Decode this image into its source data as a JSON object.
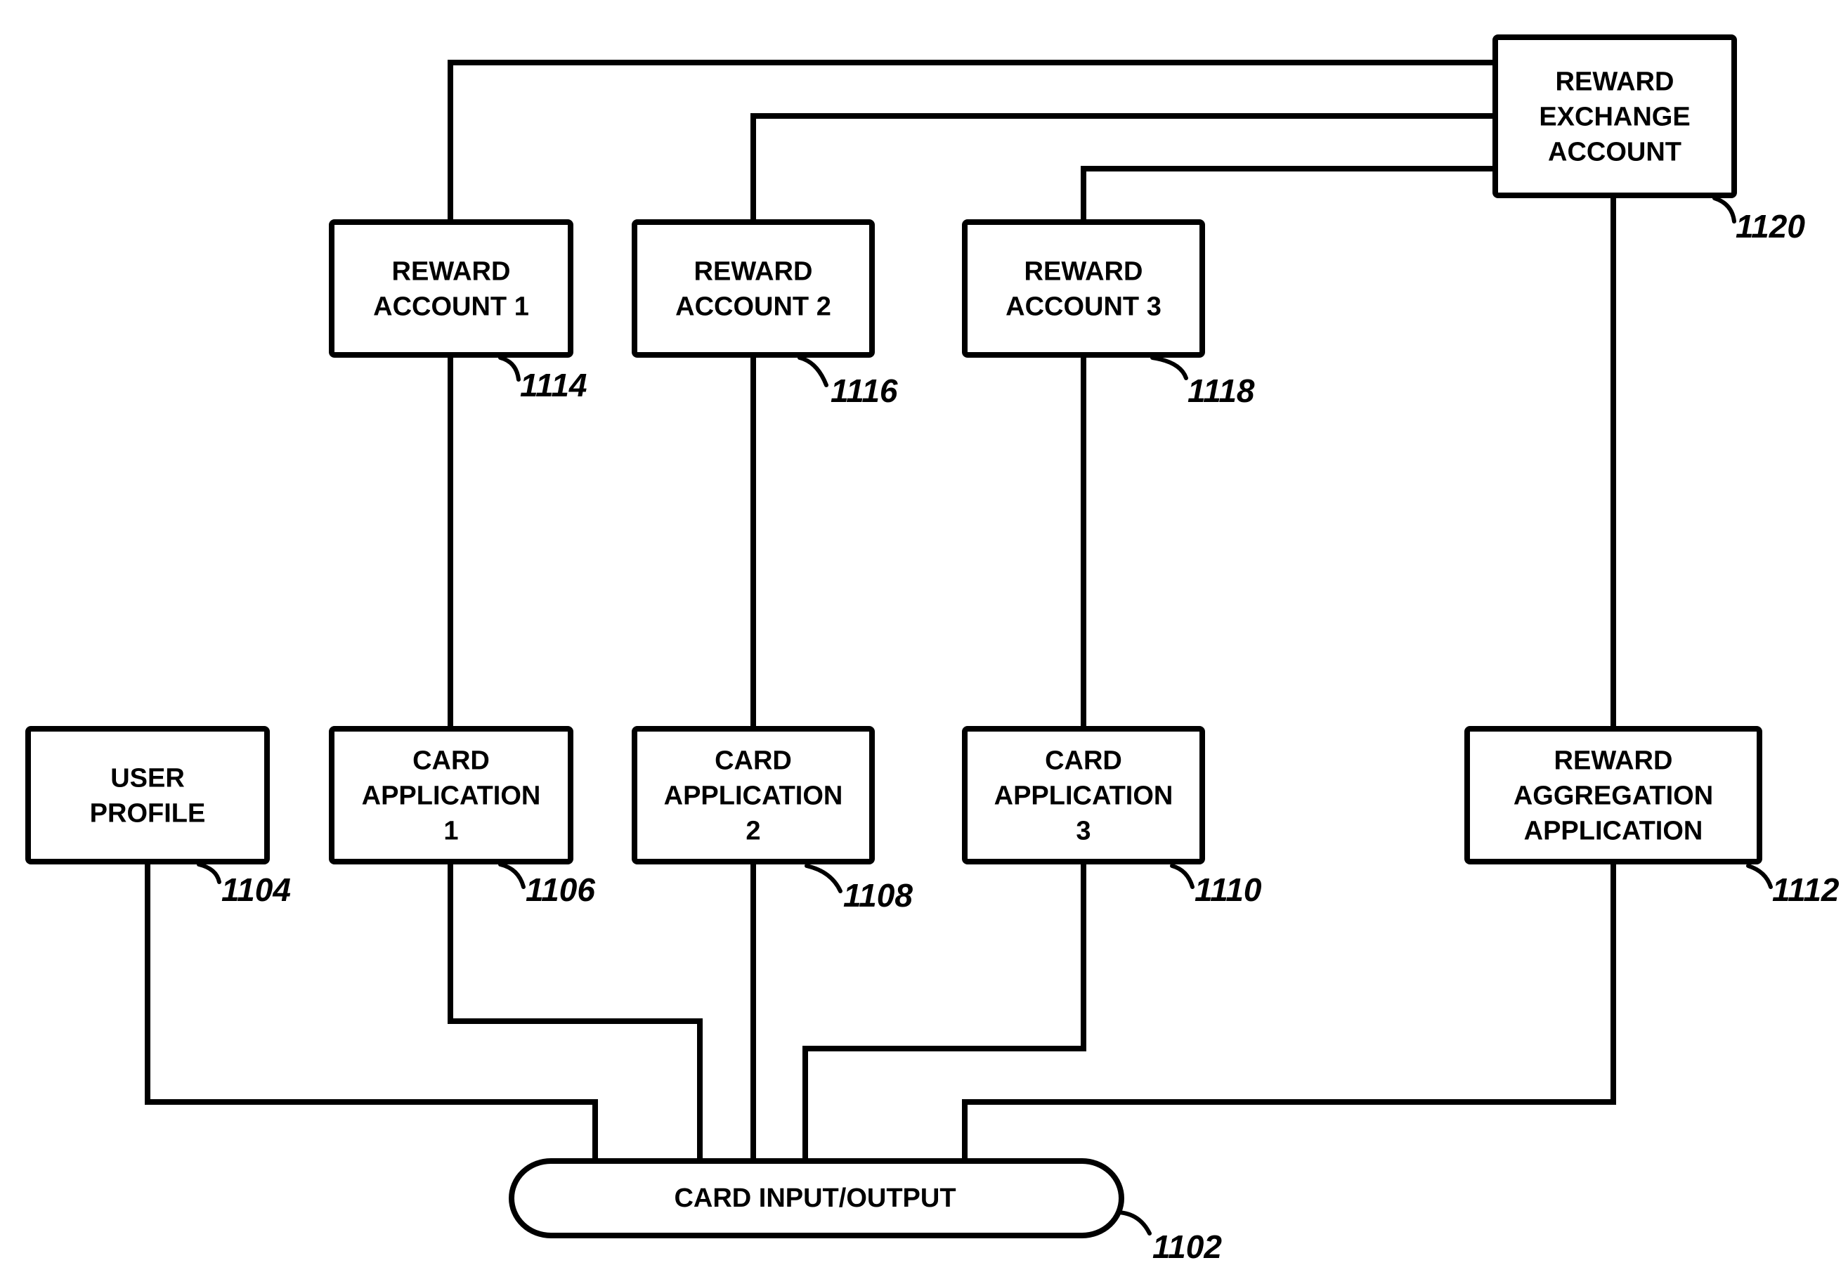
{
  "figure": {
    "nodes": {
      "reward_exchange_account": {
        "lines": [
          "REWARD",
          "EXCHANGE",
          "ACCOUNT"
        ],
        "ref": "1120"
      },
      "reward_account_1": {
        "lines": [
          "REWARD",
          "ACCOUNT 1"
        ],
        "ref": "1114"
      },
      "reward_account_2": {
        "lines": [
          "REWARD",
          "ACCOUNT 2"
        ],
        "ref": "1116"
      },
      "reward_account_3": {
        "lines": [
          "REWARD",
          "ACCOUNT 3"
        ],
        "ref": "1118"
      },
      "user_profile": {
        "lines": [
          "USER",
          "PROFILE"
        ],
        "ref": "1104"
      },
      "card_application_1": {
        "lines": [
          "CARD",
          "APPLICATION",
          "1"
        ],
        "ref": "1106"
      },
      "card_application_2": {
        "lines": [
          "CARD",
          "APPLICATION",
          "2"
        ],
        "ref": "1108"
      },
      "card_application_3": {
        "lines": [
          "CARD",
          "APPLICATION",
          "3"
        ],
        "ref": "1110"
      },
      "reward_aggregation_application": {
        "lines": [
          "REWARD",
          "AGGREGATION",
          "APPLICATION"
        ],
        "ref": "1112"
      },
      "card_input_output": {
        "lines": [
          "CARD INPUT/OUTPUT"
        ],
        "ref": "1102"
      }
    },
    "connections": [
      [
        "reward_account_1",
        "reward_exchange_account"
      ],
      [
        "reward_account_2",
        "reward_exchange_account"
      ],
      [
        "reward_account_3",
        "reward_exchange_account"
      ],
      [
        "reward_account_1",
        "card_application_1"
      ],
      [
        "reward_account_2",
        "card_application_2"
      ],
      [
        "reward_account_3",
        "card_application_3"
      ],
      [
        "reward_exchange_account",
        "reward_aggregation_application"
      ],
      [
        "user_profile",
        "card_input_output"
      ],
      [
        "card_application_1",
        "card_input_output"
      ],
      [
        "card_application_2",
        "card_input_output"
      ],
      [
        "card_application_3",
        "card_input_output"
      ],
      [
        "reward_aggregation_application",
        "card_input_output"
      ]
    ]
  }
}
